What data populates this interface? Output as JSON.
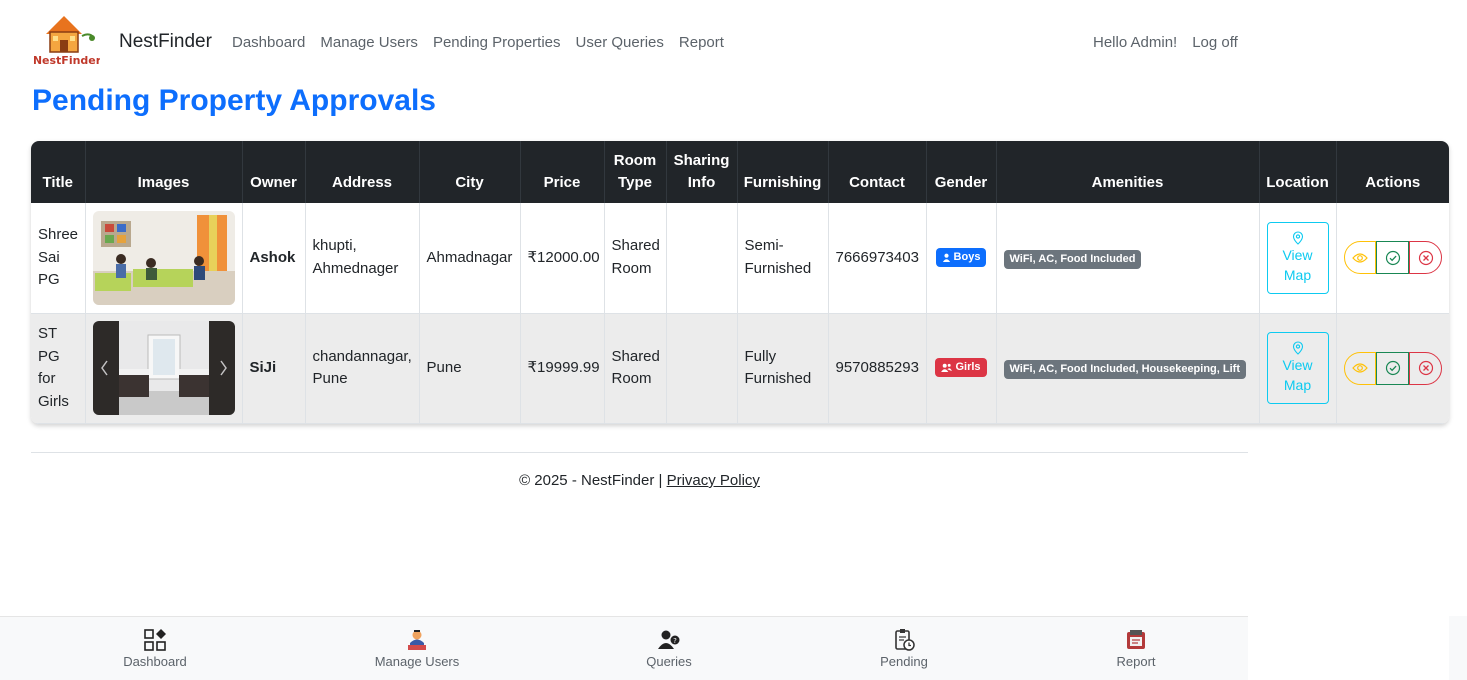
{
  "navbar": {
    "brand": "NestFinder",
    "logo_text": "NestFinder",
    "links": [
      "Dashboard",
      "Manage Users",
      "Pending Properties",
      "User Queries",
      "Report"
    ],
    "greeting": "Hello Admin!",
    "logoff": "Log off"
  },
  "page": {
    "title": "Pending Property Approvals"
  },
  "table": {
    "headers": [
      "Title",
      "Images",
      "Owner",
      "Address",
      "City",
      "Price",
      "Room Type",
      "Sharing Info",
      "Furnishing",
      "Contact",
      "Gender",
      "Amenities",
      "Location",
      "Actions"
    ],
    "rows": [
      {
        "title": "Shree Sai PG",
        "owner": "Ashok",
        "address": "khupti, Ahmednager",
        "city": "Ahmadnagar",
        "price": "₹12000.00",
        "room_type": "Shared Room",
        "sharing_info": "",
        "furnishing": "Semi-Furnished",
        "contact": "7666973403",
        "gender": "Boys",
        "amenities": "WiFi, AC, Food Included",
        "location_label": "View Map"
      },
      {
        "title": "ST PG for Girls",
        "owner": "SiJi",
        "address": "chandannagar, Pune",
        "city": "Pune",
        "price": "₹19999.99",
        "room_type": "Shared Room",
        "sharing_info": "",
        "furnishing": "Fully Furnished",
        "contact": "9570885293",
        "gender": "Girls",
        "amenities": "WiFi, AC, Food Included, Housekeeping, Lift",
        "location_label": "View Map"
      }
    ]
  },
  "footer": {
    "copyright": "© 2025 - NestFinder | ",
    "privacy": "Privacy Policy"
  },
  "bottom_nav": [
    "Dashboard",
    "Manage Users",
    "Queries",
    "Pending",
    "Report"
  ],
  "colors": {
    "primary": "#0d6efd",
    "dark": "#212529",
    "info": "#0dcaf0",
    "warning": "#ffc107",
    "success": "#198754",
    "danger": "#dc3545",
    "secondary": "#6c757d"
  }
}
